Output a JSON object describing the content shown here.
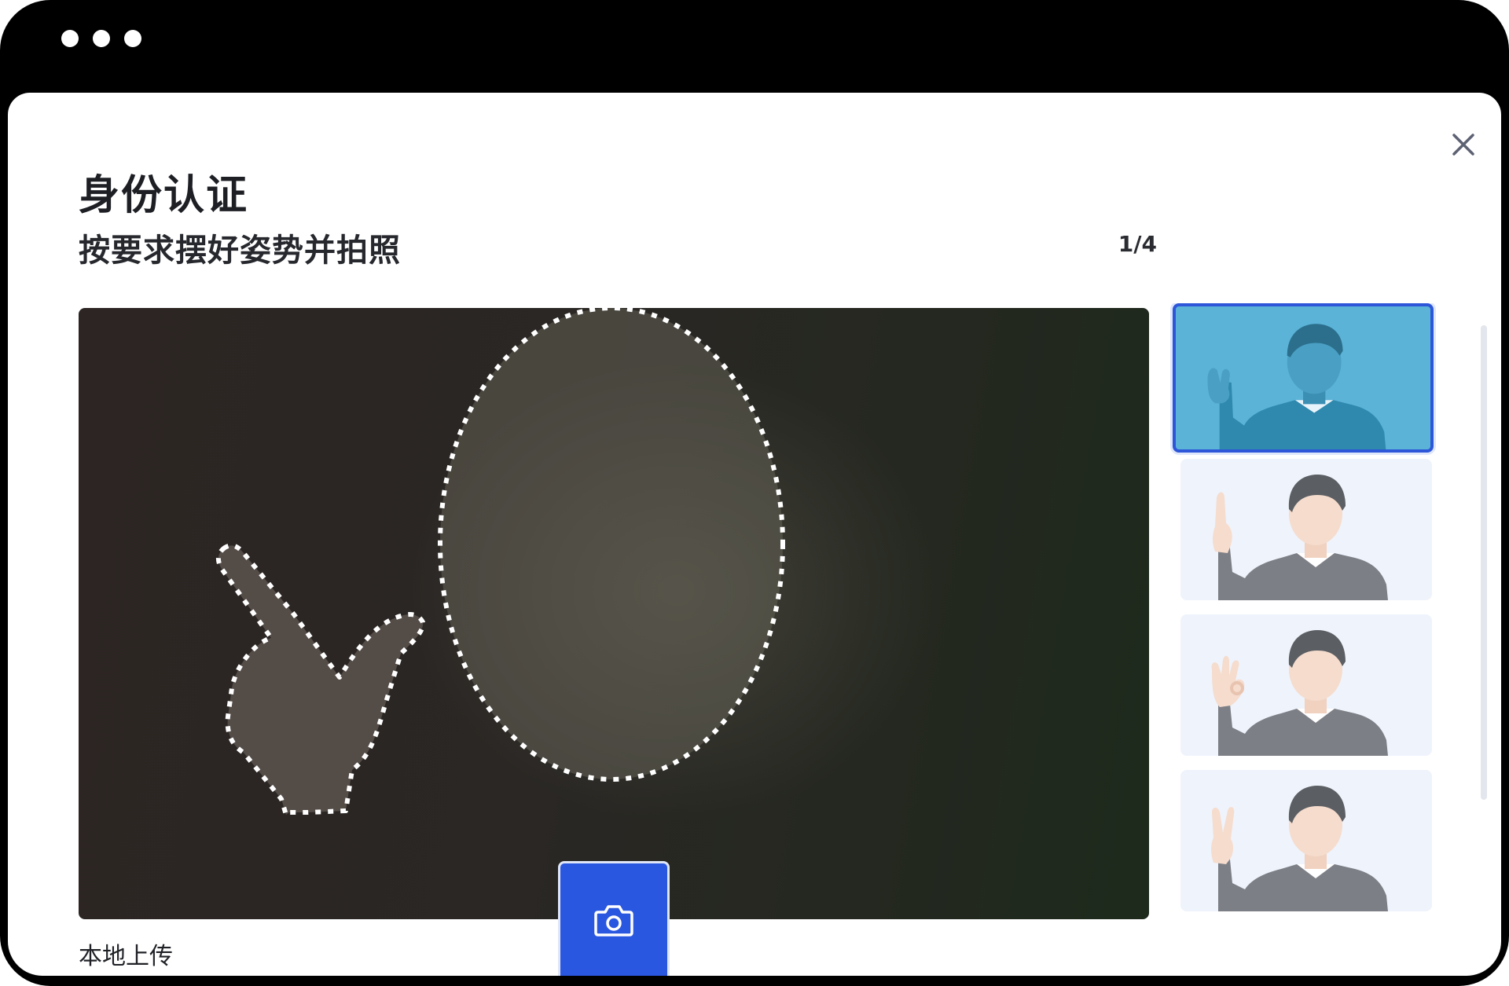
{
  "window": {
    "controls": [
      "dot",
      "dot",
      "dot"
    ]
  },
  "dialog": {
    "title": "身份认证",
    "subtitle": "按要求摆好姿势并拍照",
    "step_counter": "1/4",
    "close_icon": "close-icon"
  },
  "camera": {
    "shutter_icon": "camera-icon",
    "local_upload_label": "本地上传"
  },
  "poses": [
    {
      "gesture": "point-finger",
      "selected": true
    },
    {
      "gesture": "point-finger",
      "selected": false
    },
    {
      "gesture": "ok-sign",
      "selected": false
    },
    {
      "gesture": "v-sign",
      "selected": false
    }
  ],
  "colors": {
    "accent": "#2a57e0",
    "selected_thumb_bg": "#5bb3d8",
    "thumb_bg": "#eff3fb"
  }
}
